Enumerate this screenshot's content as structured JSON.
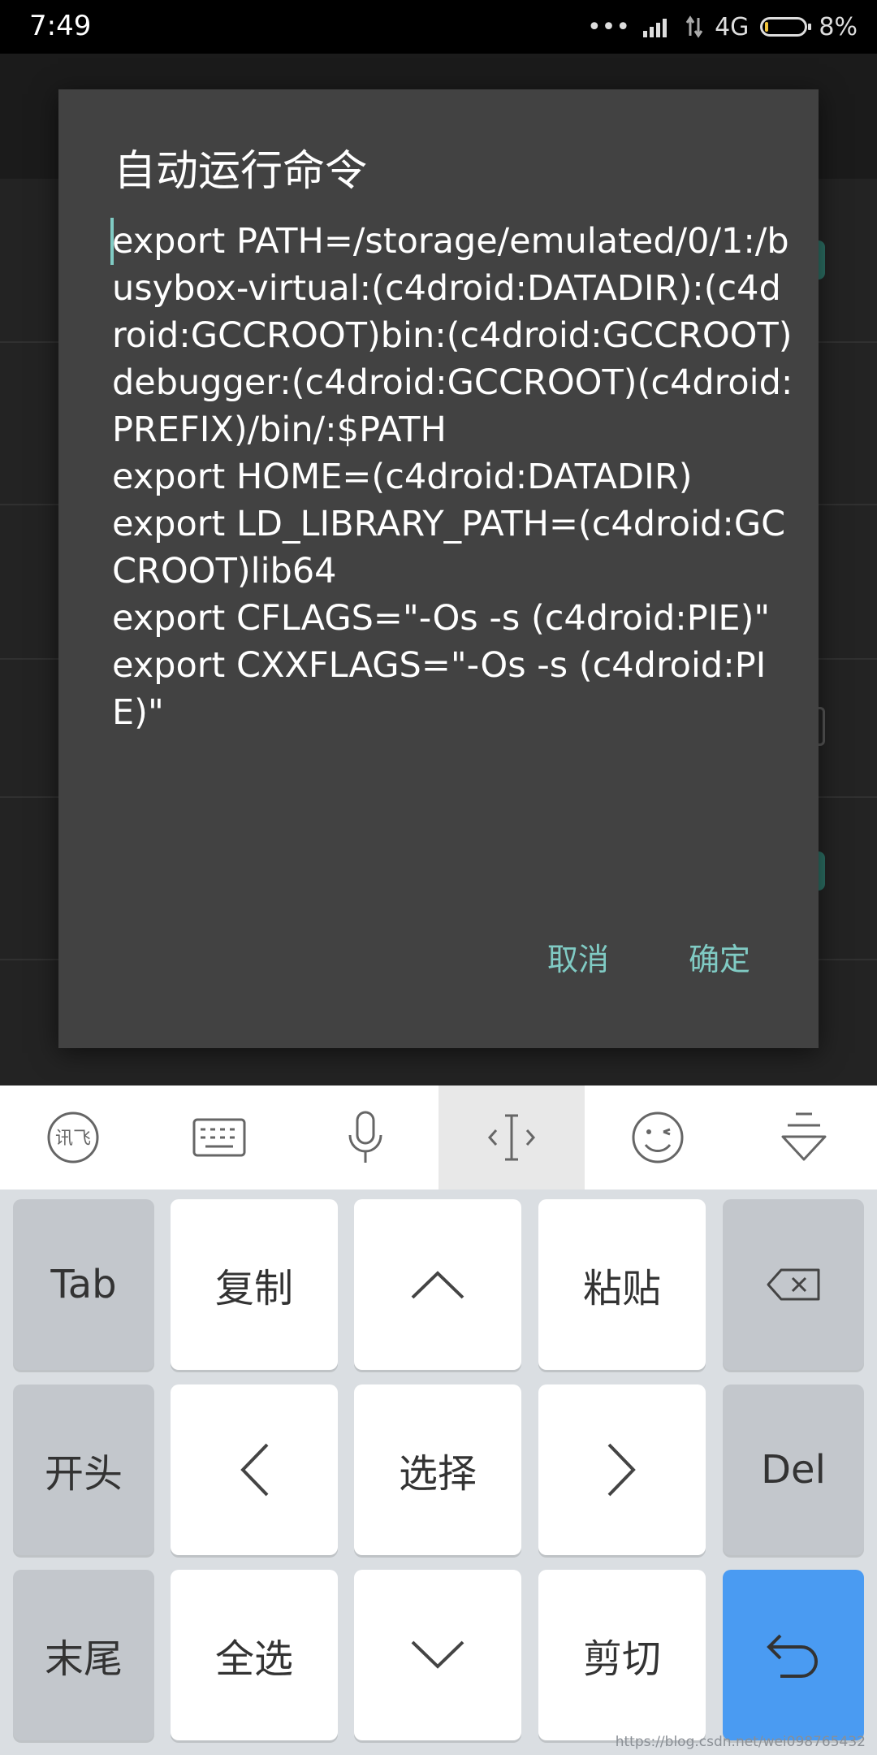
{
  "status_bar": {
    "time": "7:49",
    "network": "4G",
    "battery": "8%",
    "battery_level": 0.08
  },
  "dialog": {
    "title": "自动运行命令",
    "command_text": "export PATH=/storage/emulated/0/1:/busybox-virtual:(c4droid:DATADIR):(c4droid:GCCROOT)bin:(c4droid:GCCROOT)debugger:(c4droid:GCCROOT)(c4droid:PREFIX)/bin/:$PATH\nexport HOME=(c4droid:DATADIR)\nexport LD_LIBRARY_PATH=(c4droid:GCCROOT)lib64\nexport CFLAGS=\"-Os -s (c4droid:PIE)\"\nexport CXXFLAGS=\"-Os -s (c4droid:PIE)\"",
    "cancel_label": "取消",
    "ok_label": "确定"
  },
  "toolbar": {
    "items": [
      {
        "icon": "ifly-logo-icon"
      },
      {
        "icon": "keyboard-icon"
      },
      {
        "icon": "microphone-icon"
      },
      {
        "icon": "cursor-move-icon",
        "active": true
      },
      {
        "icon": "emoji-icon"
      },
      {
        "icon": "collapse-keyboard-icon"
      }
    ]
  },
  "keyboard": {
    "rows": [
      {
        "keys": [
          "Tab",
          "复制",
          "",
          "粘贴",
          ""
        ]
      },
      {
        "keys": [
          "开头",
          "",
          "选择",
          "",
          "Del"
        ]
      },
      {
        "keys": [
          "末尾",
          "全选",
          "",
          "剪切",
          ""
        ]
      }
    ],
    "icons": {
      "up": "chevron-up-icon",
      "down": "chevron-down-icon",
      "left": "chevron-left-icon",
      "right": "chevron-right-icon",
      "backspace": "backspace-icon",
      "enter": "return-icon"
    },
    "colors": {
      "enter_key": "#4a9bf2",
      "side_keys": "#c3c7cc"
    }
  },
  "watermark": "https://blog.csdn.net/wei098765432"
}
